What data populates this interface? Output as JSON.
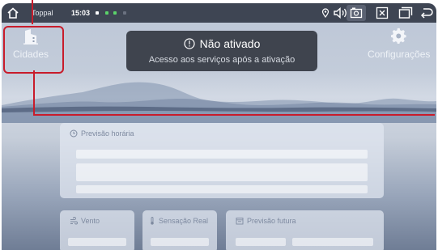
{
  "statusbar": {
    "app_label": "Toppal",
    "time": "15:03"
  },
  "tiles": {
    "left_label": "Cidades",
    "right_label": "Configurações"
  },
  "toast": {
    "title": "Não ativado",
    "subtitle": "Acesso aos serviços após a ativação"
  },
  "cards": {
    "hourly_title": "Previsão horária",
    "wind_title": "Vento",
    "feels_title": "Sensação Real",
    "future_title": "Previsão futura"
  },
  "colors": {
    "annotation": "#c81c2b",
    "statusbar": "#3e4553"
  },
  "icons": [
    "home-icon",
    "location-icon",
    "volume-icon",
    "screenshot-icon",
    "close-window-icon",
    "window-icon",
    "back-icon",
    "building-icon",
    "gear-icon",
    "alert-circle-icon",
    "clock-icon",
    "wind-icon",
    "thermometer-icon",
    "calendar-icon"
  ]
}
